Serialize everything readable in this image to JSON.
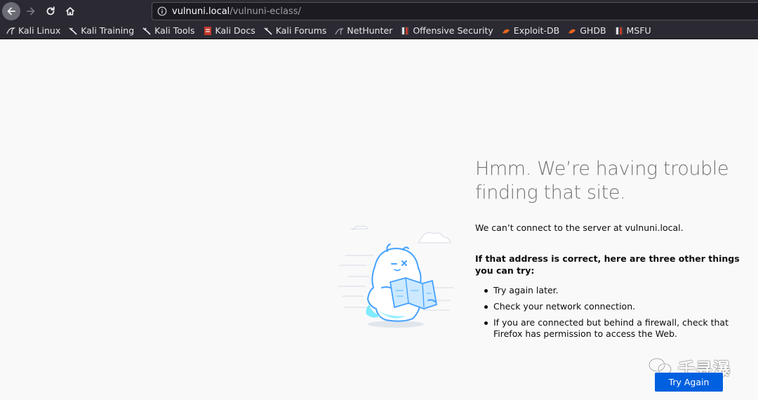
{
  "browser": {
    "url_host": "vulnuni.local",
    "url_path": "/vulnuni-eclass/",
    "nav_icons": [
      "back-arrow-icon",
      "forward-arrow-icon",
      "reload-icon",
      "home-icon"
    ]
  },
  "bookmarks": [
    {
      "label": "Kali Linux",
      "icon": "kali-dragon-icon"
    },
    {
      "label": "Kali Training",
      "icon": "kali-dragon-icon"
    },
    {
      "label": "Kali Tools",
      "icon": "kali-dragon-icon"
    },
    {
      "label": "Kali Docs",
      "icon": "kali-docs-icon"
    },
    {
      "label": "Kali Forums",
      "icon": "kali-dragon-icon"
    },
    {
      "label": "NetHunter",
      "icon": "nethunter-icon"
    },
    {
      "label": "Offensive Security",
      "icon": "offsec-icon"
    },
    {
      "label": "Exploit-DB",
      "icon": "exploit-db-icon"
    },
    {
      "label": "GHDB",
      "icon": "exploit-db-icon"
    },
    {
      "label": "MSFU",
      "icon": "offsec-icon"
    }
  ],
  "error": {
    "title": "Hmm. We’re having trouble finding that site.",
    "description": "We can’t connect to the server at vulnuni.local.",
    "tips_heading": "If that address is correct, here are three other things you can try:",
    "tips": [
      "Try again later.",
      "Check your network connection.",
      "If you are connected but behind a firewall, check that Firefox has permission to access the Web."
    ],
    "try_again": "Try Again"
  },
  "watermark": {
    "text": "千寻瀑"
  },
  "colors": {
    "toolbar": "#2b2a33",
    "accent": "#0060df",
    "title": "#737373"
  }
}
